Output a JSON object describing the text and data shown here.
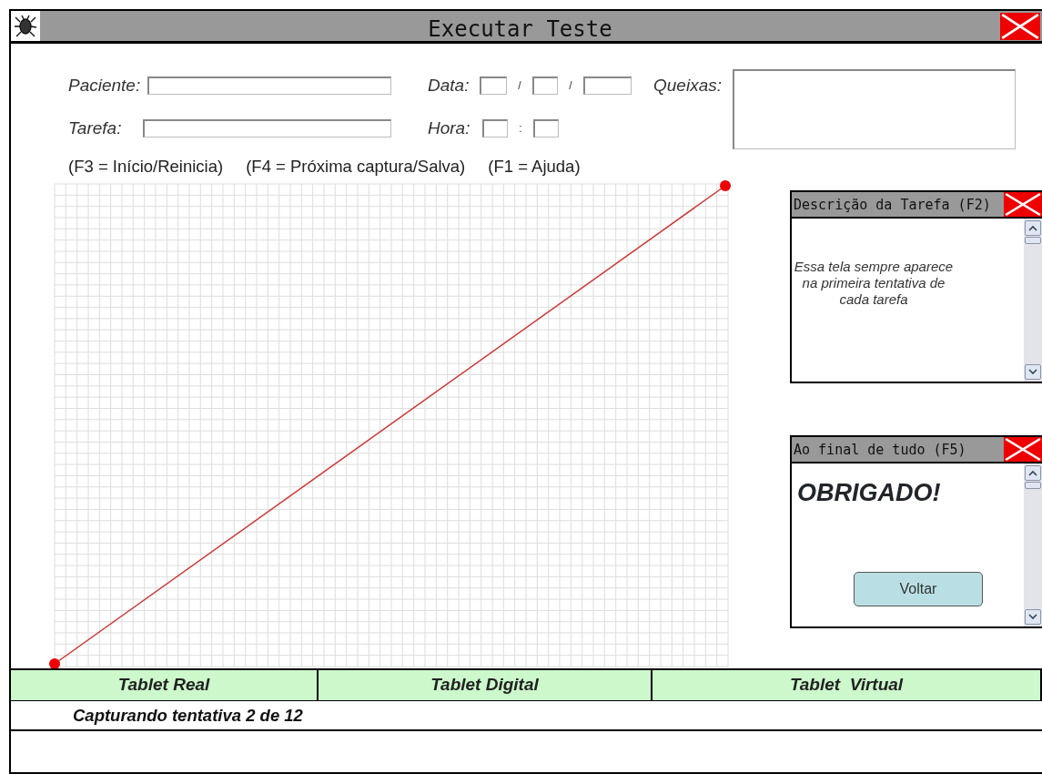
{
  "window": {
    "title": "Executar Teste"
  },
  "patient": {
    "label": "Paciente:"
  },
  "task": {
    "label": "Tarefa:"
  },
  "date": {
    "label": "Data:",
    "separators": [
      "/",
      "/"
    ]
  },
  "time": {
    "label": "Hora:",
    "separator": ":"
  },
  "complaints": {
    "label": "Queixas:"
  },
  "shortcuts": [
    "(F3 = Início/Reinicia)",
    "(F4 = Próxima captura/Salva)",
    "(F1 = Ajuda)"
  ],
  "panels": [
    {
      "title": "Descrição da Tarefa (F2)",
      "kind": "text",
      "text": "Essa tela sempre aparece na primeira tentativa de cada tarefa"
    },
    {
      "title": "Ao final de tudo (F5)",
      "kind": "message",
      "heading": "OBRIGADO!",
      "button": "Voltar"
    }
  ],
  "modes": [
    "Tablet Real",
    "Tablet Digital",
    "Tablet  Virtual"
  ],
  "status": "Capturando tentativa 2 de 12"
}
